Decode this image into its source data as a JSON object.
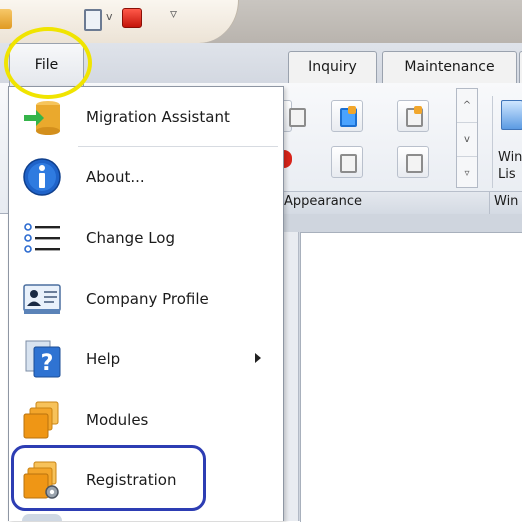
{
  "ribbon": {
    "tabs": [
      "Inquiry",
      "Maintenance"
    ],
    "group_appearance": "Appearance",
    "group_windows_partial": "Win",
    "windows_button_partial": [
      "Win",
      "Lis"
    ],
    "scroll_up": "^",
    "scroll_down": "v",
    "scroll_more": "▿"
  },
  "qat": {
    "dropdown_glyph": "▿",
    "small_arrow": "v"
  },
  "file_menu": {
    "tab_label": "File",
    "items": [
      {
        "label": "Migration Assistant",
        "icon": "migration-icon"
      },
      {
        "label": "About...",
        "icon": "info-icon"
      },
      {
        "label": "Change Log",
        "icon": "list-icon"
      },
      {
        "label": "Company Profile",
        "icon": "id-card-icon"
      },
      {
        "label": "Help",
        "icon": "help-icon"
      },
      {
        "label": "Modules",
        "icon": "modules-icon"
      },
      {
        "label": "Registration",
        "icon": "registration-icon"
      }
    ]
  },
  "colors": {
    "highlight_circle": "#f0e400",
    "highlight_box": "#2d3db3",
    "info_blue": "#1f63c9",
    "module_orange": "#f3a52a"
  }
}
